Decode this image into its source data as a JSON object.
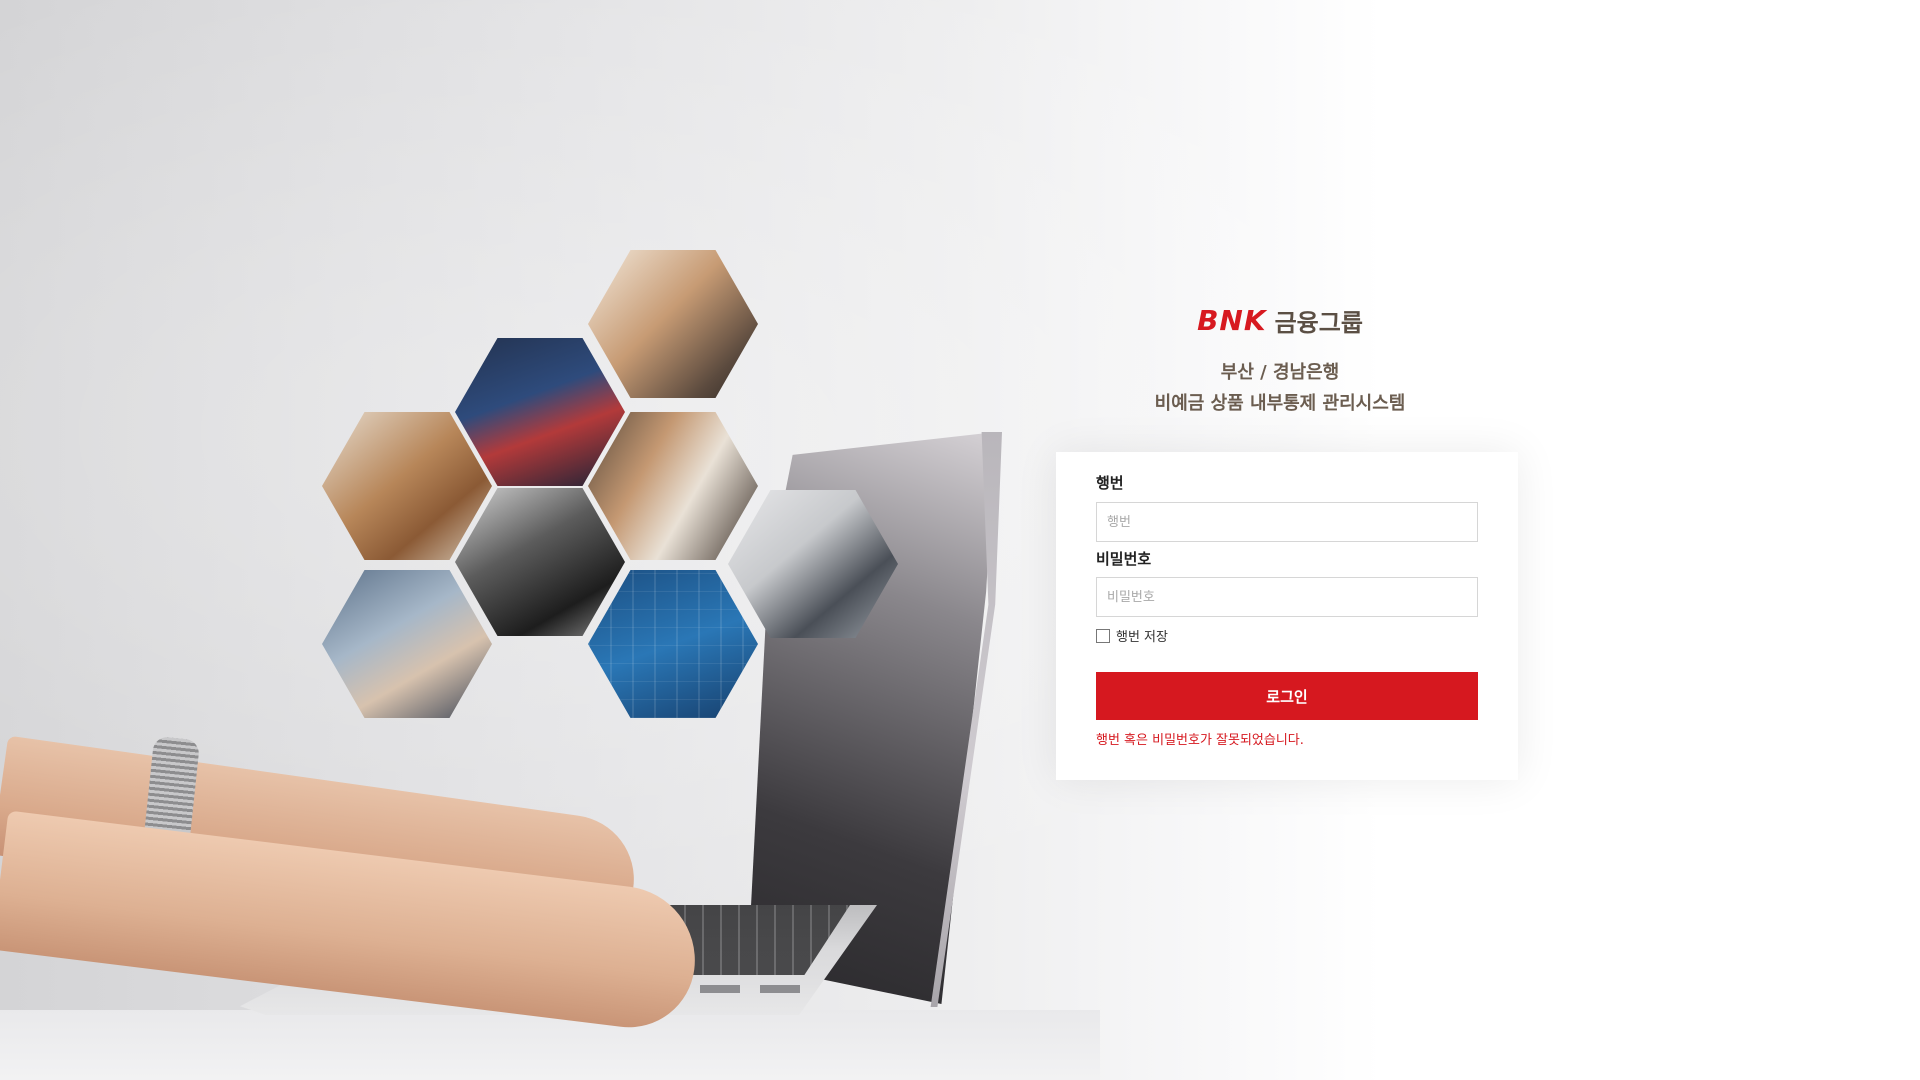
{
  "brand": {
    "logo_text": "BNK",
    "group_text": "금융그룹",
    "accent_color": "#d71920"
  },
  "header": {
    "line1": "부산 / 경남은행",
    "line2": "비예금 상품 내부통제 관리시스템"
  },
  "login": {
    "id_label": "행번",
    "id_placeholder": "행번",
    "id_value": "",
    "password_label": "비밀번호",
    "password_placeholder": "비밀번호",
    "password_value": "",
    "remember_label": "행번 저장",
    "remember_checked": false,
    "submit_label": "로그인",
    "error_message": "행번 혹은 비밀번호가 잘못되었습니다."
  },
  "hero": {
    "hex_images": [
      "office-laptop-meeting",
      "trading-screen-phone",
      "desk-laptops-teamwork",
      "fist-bump-teamwork",
      "laptop-typing-bw",
      "team-standing-discussion",
      "laptop-pointing",
      "financial-chart-blue"
    ]
  }
}
